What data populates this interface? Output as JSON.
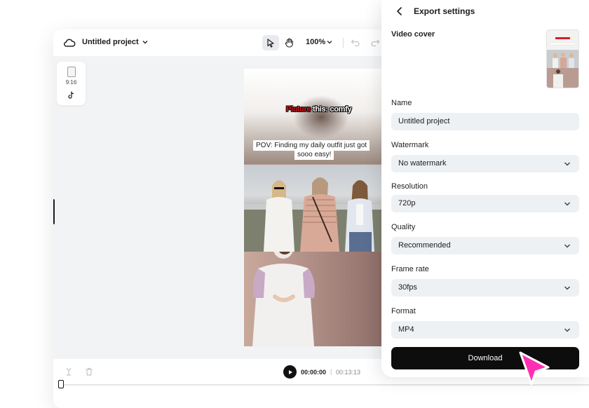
{
  "editor": {
    "project_title": "Untitled project",
    "zoom": "100%",
    "aspect_ratio": "9:16",
    "tools": [
      "select-tool",
      "hand-tool"
    ]
  },
  "video": {
    "headline_highlight": "Picture",
    "headline_rest": " this: comfy",
    "caption_line1": "POV: Finding my daily outfit just got",
    "caption_line2": "sooo easy!"
  },
  "timeline": {
    "current_time": "00:00:00",
    "separator": "|",
    "total_time": "00:13:13"
  },
  "export": {
    "title": "Export settings",
    "video_cover_label": "Video cover",
    "fields": {
      "name": {
        "label": "Name",
        "value": "Untitled project"
      },
      "watermark": {
        "label": "Watermark",
        "value": "No watermark"
      },
      "resolution": {
        "label": "Resolution",
        "value": "720p"
      },
      "quality": {
        "label": "Quality",
        "value": "Recommended"
      },
      "frame_rate": {
        "label": "Frame rate",
        "value": "30fps"
      },
      "format": {
        "label": "Format",
        "value": "MP4"
      }
    },
    "download_label": "Download"
  },
  "colors": {
    "accent_cursor": "#ff2fb4",
    "headline_red": "#e8151d",
    "download_bg": "#0d0d0d",
    "field_bg": "#eef1f4"
  }
}
